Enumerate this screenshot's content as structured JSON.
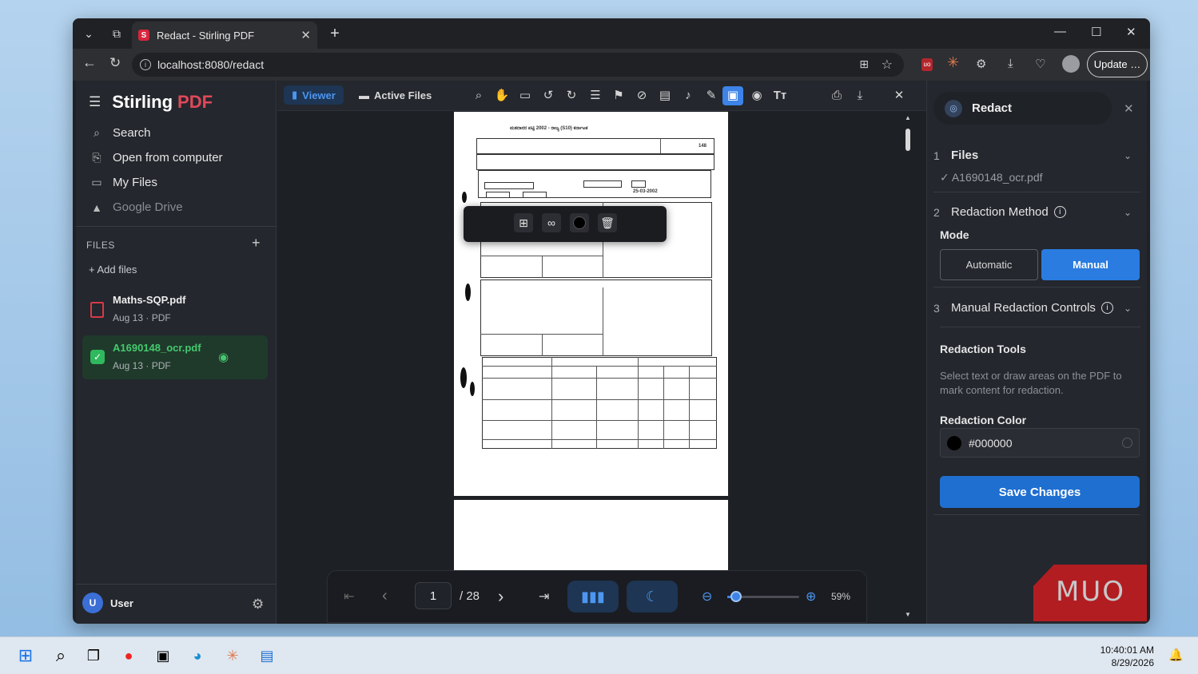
{
  "browser": {
    "tab_title": "Redact - Stirling PDF",
    "url": "localhost:8080/redact",
    "update_label": "Update …"
  },
  "sidebar": {
    "logo_main": "Stirling",
    "logo_accent": "PDF",
    "nav": [
      {
        "label": "Search",
        "icon": "search-icon"
      },
      {
        "label": "Open from computer",
        "icon": "file-upload-icon"
      },
      {
        "label": "My Files",
        "icon": "folder-icon"
      },
      {
        "label": "Google Drive",
        "icon": "google-drive-icon"
      }
    ],
    "files_header": "FILES",
    "add_files": "+ Add files",
    "files": [
      {
        "name": "Maths-SQP.pdf",
        "meta": "Aug 13 · PDF",
        "selected": false
      },
      {
        "name": "A1690148_ocr.pdf",
        "meta": "Aug 13 · PDF",
        "selected": true
      }
    ],
    "user_initial": "U",
    "user_name": "User"
  },
  "viewer": {
    "tab_viewer": "Viewer",
    "tab_active_files": "Active Files",
    "tools": [
      "search-icon",
      "pan-hand-icon",
      "ruler-icon",
      "rotate-left-icon",
      "rotate-right-icon",
      "list-icon",
      "bookmark-icon",
      "attachment-icon",
      "comment-icon",
      "audio-icon",
      "pen-icon",
      "redact-icon",
      "eye-icon",
      "text-icon"
    ],
    "page_current": "1",
    "page_total": "/ 28",
    "zoom": "59%",
    "zoom_fraction": 0.12,
    "doc_title": "ಮತದಾರರ ಪಟ್ಟಿ 2002 - ರಾಜ್ಯ (S10) ಕರ್ನಾಟಕ",
    "doc_number": "148",
    "doc_date": "25-03-2002",
    "doc_year": "2002"
  },
  "panel": {
    "title": "Redact",
    "step1_num": "1",
    "step1_label": "Files",
    "step1_file": "✓ A1690148_ocr.pdf",
    "step2_num": "2",
    "step2_label": "Redaction Method",
    "mode_label": "Mode",
    "mode_automatic": "Automatic",
    "mode_manual": "Manual",
    "step3_num": "3",
    "step3_label": "Manual Redaction Controls",
    "tools_title": "Redaction Tools",
    "tools_desc": "Select text or draw areas on the PDF to mark content for redaction.",
    "color_label": "Redaction Color",
    "color_value": "#000000",
    "save_label": "Save Changes"
  },
  "watermark": "MUO",
  "taskbar": {
    "time": "10:40:01 AM",
    "date": "8/29/2026"
  }
}
